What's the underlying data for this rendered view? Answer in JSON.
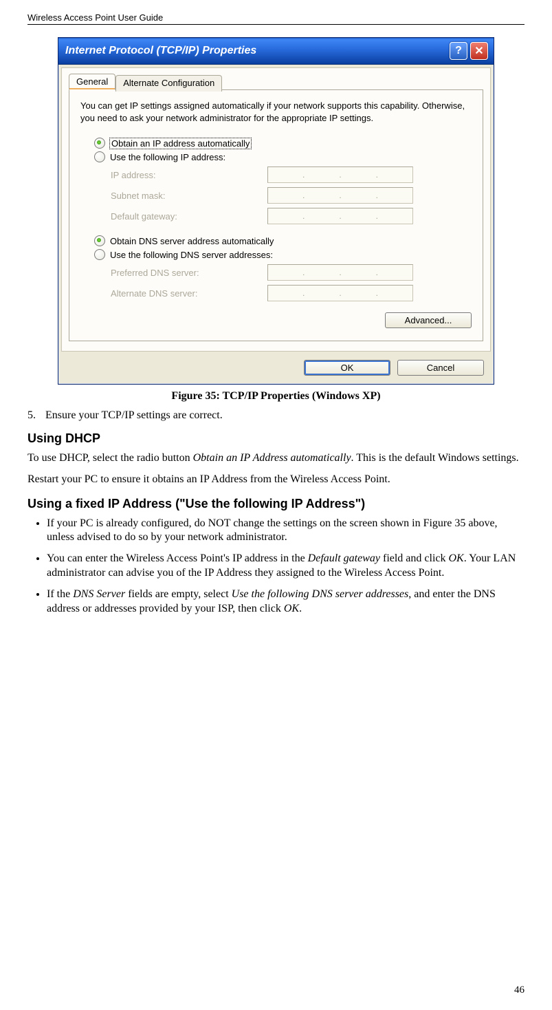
{
  "doc": {
    "header": "Wireless Access Point User Guide",
    "page_number": "46"
  },
  "dialog": {
    "title": "Internet Protocol (TCP/IP) Properties",
    "help_symbol": "?",
    "close_symbol": "✕",
    "tabs": {
      "general": "General",
      "alt": "Alternate Configuration"
    },
    "desc": "You can get IP settings assigned automatically if your network supports this capability. Otherwise, you need to ask your network administrator for the appropriate IP settings.",
    "radios": {
      "auto_ip": "Obtain an IP address automatically",
      "use_ip": "Use the following IP address:",
      "auto_dns": "Obtain DNS server address automatically",
      "use_dns": "Use the following DNS server addresses:"
    },
    "fields": {
      "ip": "IP address:",
      "subnet": "Subnet mask:",
      "gateway": "Default gateway:",
      "pref_dns": "Preferred DNS server:",
      "alt_dns": "Alternate DNS server:"
    },
    "buttons": {
      "advanced": "Advanced...",
      "ok": "OK",
      "cancel": "Cancel"
    }
  },
  "caption": "Figure 35: TCP/IP Properties (Windows XP)",
  "step5": {
    "num": "5.",
    "text": "Ensure your TCP/IP settings are correct."
  },
  "heading_dhcp": "Using DHCP",
  "dhcp_p1a": "To use DHCP, select the radio button ",
  "dhcp_p1_ital": "Obtain an IP Address automatically",
  "dhcp_p1b": ". This is the default Windows settings.",
  "dhcp_p2": "Restart your PC to ensure it obtains an IP Address from the Wireless Access Point.",
  "heading_fixed": "Using a fixed IP Address (\"Use the following IP Address\")",
  "b1": "If your PC is already configured, do NOT change the settings on the screen shown in Figure 35 above, unless advised to do so by your network administrator.",
  "b2a": "You can enter the Wireless Access Point's IP address in the ",
  "b2_ital1": "Default gateway",
  "b2b": " field and click ",
  "b2_ital2": "OK",
  "b2c": ". Your LAN administrator can advise you of the IP Address they assigned to the Wireless Access Point.",
  "b3a": "If the ",
  "b3_ital1": "DNS Server",
  "b3b": " fields are empty, select ",
  "b3_ital2": "Use the following DNS server addresses",
  "b3c": ", and enter the DNS address or addresses provided by your ISP, then click ",
  "b3_ital3": "OK",
  "b3d": "."
}
